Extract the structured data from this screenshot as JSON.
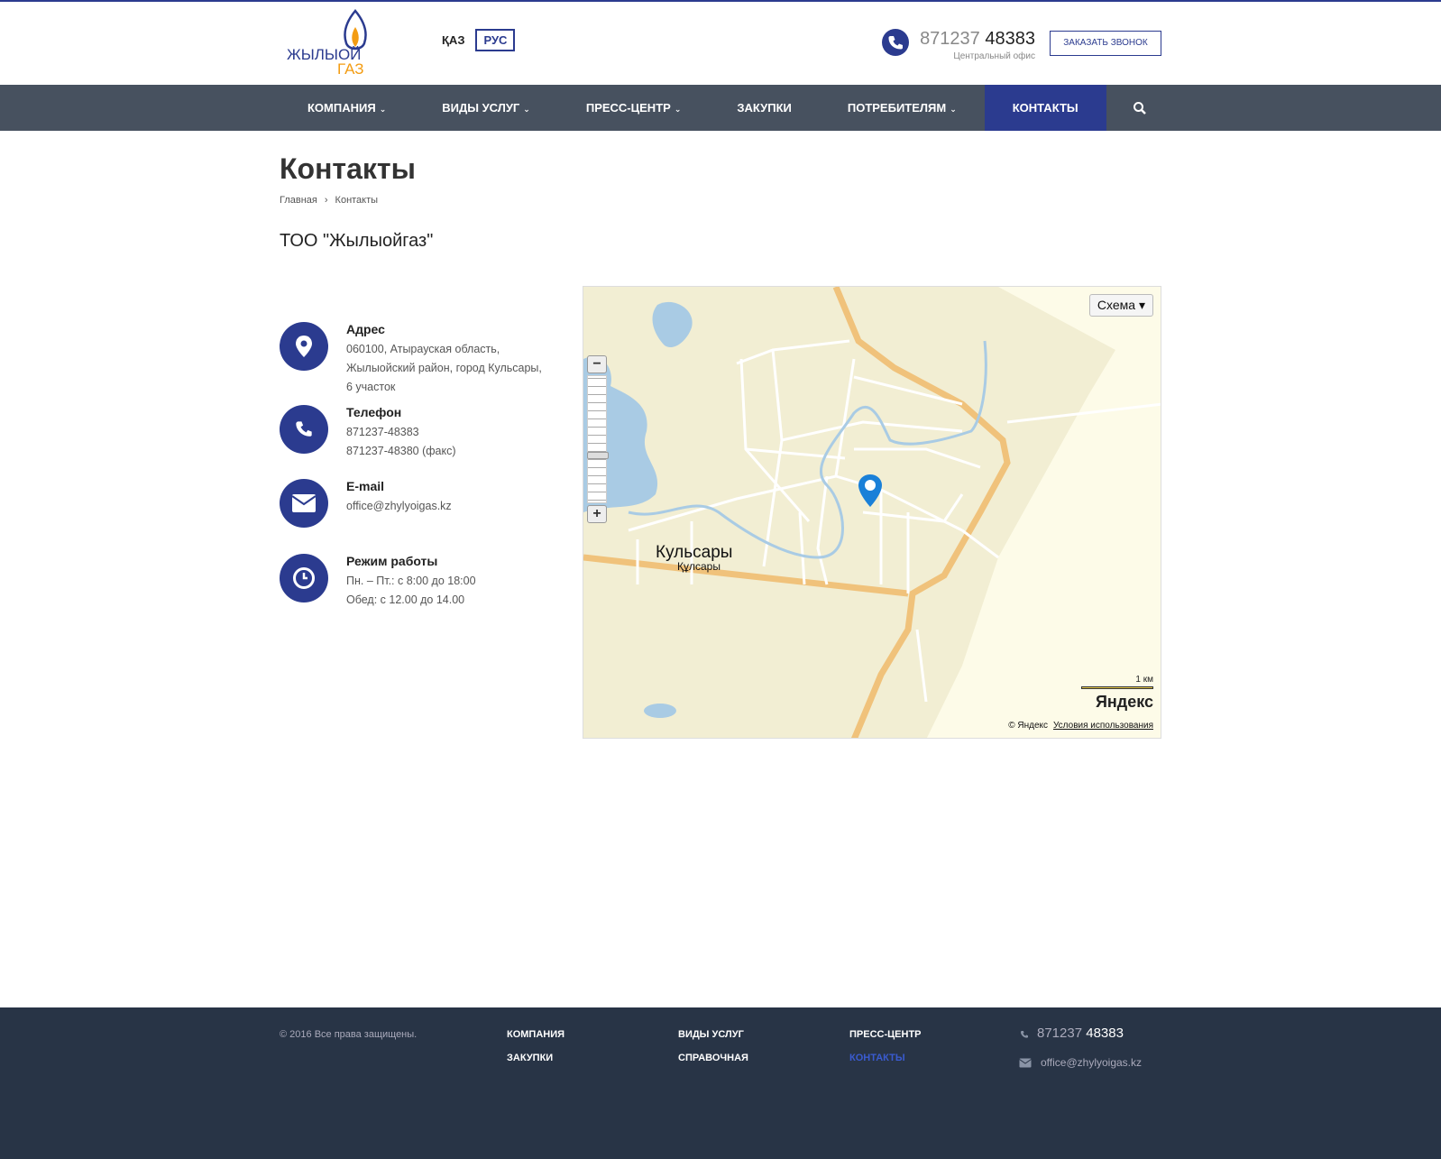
{
  "header": {
    "logo_text_1": "ЖЫЛЫОЙ",
    "logo_text_2": "ГАЗ",
    "lang_kz": "ҚАЗ",
    "lang_ru": "РУС",
    "phone_code": "871237",
    "phone_number": "48383",
    "phone_caption": "Центральный офис",
    "callback_label": "ЗАКАЗАТЬ ЗВОНОК"
  },
  "nav": {
    "items": [
      {
        "label": "КОМПАНИЯ",
        "dropdown": true
      },
      {
        "label": "ВИДЫ УСЛУГ",
        "dropdown": true
      },
      {
        "label": "ПРЕСС-ЦЕНТР",
        "dropdown": true
      },
      {
        "label": "ЗАКУПКИ",
        "dropdown": false
      },
      {
        "label": "ПОТРЕБИТЕЛЯМ",
        "dropdown": true
      },
      {
        "label": "КОНТАКТЫ",
        "dropdown": false,
        "active": true
      }
    ],
    "search_icon": "search-icon"
  },
  "page": {
    "title": "Контакты",
    "breadcrumb": {
      "home": "Главная",
      "current": "Контакты"
    },
    "company": "ТОО \"Жылыойгаз\""
  },
  "contacts": {
    "address": {
      "title": "Адрес",
      "lines": [
        "060100, Атырауская область,",
        "Жылыойский район, город Кульсары,",
        "6 участок"
      ]
    },
    "phone": {
      "title": "Телефон",
      "lines": [
        "871237-48383",
        "871237-48380 (факс)"
      ]
    },
    "email": {
      "title": "E-mail",
      "lines": [
        "office@zhylyoigas.kz"
      ]
    },
    "hours": {
      "title": "Режим работы",
      "lines": [
        "Пн. – Пт.: с 8:00 до 18:00",
        "Обед: с 12.00 до 14.00"
      ]
    }
  },
  "map": {
    "type_selector": "Схема ▾",
    "city_name": "Кульсары",
    "city_name_kz": "Құлсары",
    "scale_label": "1 км",
    "brand": "Яндекс",
    "copyright": "© Яндекс",
    "terms_link": "Условия использования",
    "zoom_in": "+",
    "zoom_out": "−"
  },
  "footer": {
    "copyright": "© 2016 Все права защищены.",
    "links": [
      "КОМПАНИЯ",
      "ВИДЫ УСЛУГ",
      "ПРЕСС-ЦЕНТР",
      "ЗАКУПКИ",
      "СПРАВОЧНАЯ",
      "КОНТАКТЫ"
    ],
    "phone_code": "871237",
    "phone_number": "48383",
    "email": "office@zhylyoigas.kz"
  },
  "colors": {
    "brand_blue": "#2b3b8f",
    "nav_bg": "#47515f",
    "footer_bg": "#283446",
    "logo_orange": "#f39c12"
  }
}
